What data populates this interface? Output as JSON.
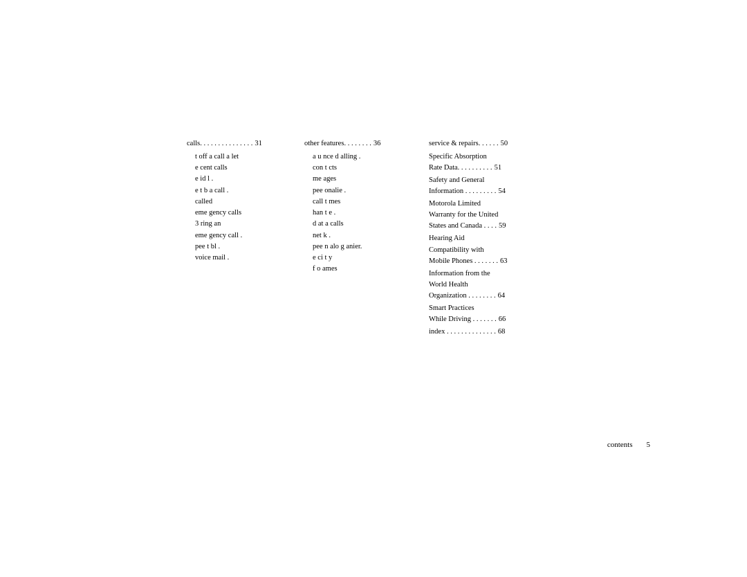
{
  "columns": {
    "col1": {
      "header": {
        "text": "calls",
        "dots": " . . . . . . . . . . . . . . .",
        "num": "31"
      },
      "items": [
        "t off a call a let",
        "e cent calls",
        "e id l .",
        "e t b a call .",
        "called",
        "eme gency calls",
        "3 ring an",
        "eme gency call .",
        "pee t bl .",
        "voice mail ."
      ]
    },
    "col2": {
      "header": {
        "text": "other features",
        "dots": " . . . . . . . .",
        "num": "36"
      },
      "items": [
        "a u nce d alling .",
        "con t cts",
        "me ages",
        "pee onalie .",
        "call t mes",
        "han t e .",
        "d at a calls",
        "net k .",
        "pee n alo g anier.",
        "e ci t y",
        "f o ames"
      ]
    },
    "col3": {
      "header": {
        "text": "service & repairs",
        "dots": ". . . . . .",
        "num": "50"
      },
      "sections": [
        {
          "lines": [
            "Specific Absorption"
          ],
          "dotline": "Rate Data. . . . . . . . . .",
          "num": "51"
        },
        {
          "lines": [
            "Safety and General"
          ],
          "dotline": "Information . . . . . . . . .",
          "num": "54"
        },
        {
          "lines": [
            "Motorola Limited",
            "Warranty for the United",
            "States and Canada . . . ."
          ],
          "num": "59"
        },
        {
          "lines": [
            "Hearing Aid",
            "Compatibility with"
          ],
          "dotline": "Mobile Phones . . . . . . .",
          "num": "63"
        },
        {
          "lines": [
            "Information from the",
            "World Health"
          ],
          "dotline": "Organization . . . . . . . .",
          "num": "64"
        },
        {
          "lines": [
            "Smart Practices",
            "While Driving . . . . . . ."
          ],
          "num": "66"
        },
        {
          "lines": [
            "index . . . . . . . . . . . . . ."
          ],
          "num": "68"
        }
      ]
    }
  },
  "footer": {
    "label": "contents",
    "page": "5"
  }
}
